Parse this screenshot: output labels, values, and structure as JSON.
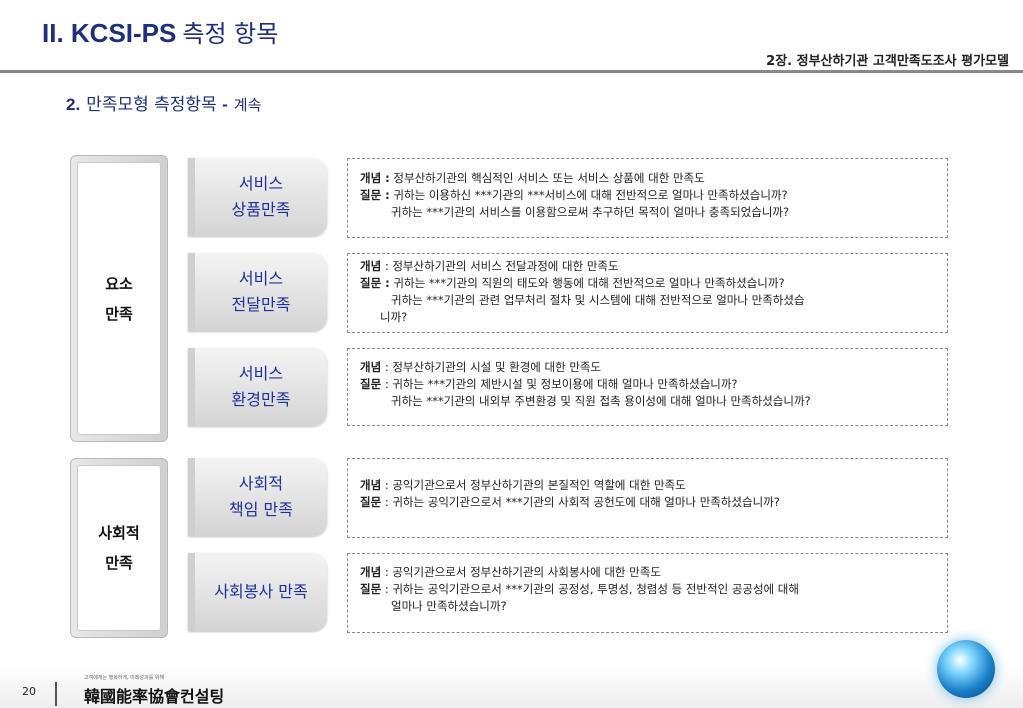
{
  "title": {
    "bold": "II. KCSI-PS",
    "rest": "측정 항목"
  },
  "chapter": "2장. 정부산하기관 고객만족도조사 평가모델",
  "section": {
    "num": "2.",
    "text": "만족모형 측정항목",
    "dash": "-",
    "cont": "계속"
  },
  "groups": [
    {
      "lines": [
        "요소",
        "만족"
      ]
    },
    {
      "lines": [
        "사회적",
        "만족"
      ]
    }
  ],
  "categories": [
    {
      "lines": [
        "서비스",
        "상품만족"
      ]
    },
    {
      "lines": [
        "서비스",
        "전달만족"
      ]
    },
    {
      "lines": [
        "서비스",
        "환경만족"
      ]
    },
    {
      "lines": [
        "사회적",
        "책임 만족"
      ]
    },
    {
      "lines": [
        "사회봉사 만족"
      ]
    }
  ],
  "descriptions": [
    {
      "concept_label": "개념 :",
      "concept": " 정부산하기관의 핵심적인 서비스 또는 서비스 상품에 대한 만족도",
      "question_label": "질문 :",
      "q1": " 귀하는 이용하신 ***기관의 ***서비스에 대해 전반적으로 얼마나 만족하셨습니까?",
      "q2": "귀하는 ***기관의 서비스를 이용함으로써 추구하던 목적이 얼마나 충족되었습니까?"
    },
    {
      "concept_label": "개념",
      "concept": " : 정부산하기관의 서비스 전달과정에 대한 만족도",
      "question_label": "질문 :",
      "q1": " 귀하는 ***기관의 직원의 태도와 행동에 대해 전반적으로 얼마나 만족하셨습니까?",
      "q2": "귀하는 ***기관의 관련 업무처리 절차 및 시스템에 대해 전반적으로 얼마나 만족하셨습",
      "q3": "니까?"
    },
    {
      "concept_label": "개념",
      "concept": " : 정부산하기관의 시설 및 환경에 대한 만족도",
      "question_label": "질문",
      "q1": " : 귀하는 ***기관의 제반시설 및 정보이용에 대해 얼마나 만족하셨습니까?",
      "q2": "귀하는 ***기관의 내외부 주변환경 및 직원 접촉 용이성에 대해 얼마나 만족하셨습니까?"
    },
    {
      "concept_label": "개념",
      "concept": " : 공익기관으로서 정부산하기관의 본질적인 역할에 대한 만족도",
      "question_label": "질문",
      "q1": " : 귀하는 공익기관으로서 ***기관의 사회적 공헌도에 대해 얼마나 만족하셨습니까?"
    },
    {
      "concept_label": "개념",
      "concept": " : 공익기관으로서 정부산하기관의 사회봉사에 대한 만족도",
      "question_label": "질문",
      "q1": " : 귀하는 공익기관으로서 ***기관의 공정성, 투명성, 청렴성 등 전반적인 공공성에 대해",
      "q2": "얼마나 만족하셨습니까?"
    }
  ],
  "footer": {
    "page": "20",
    "logo_small": "고객에게는 행복하게, 미래성과를 위해",
    "logo": "韓國能率協會컨설팅"
  }
}
